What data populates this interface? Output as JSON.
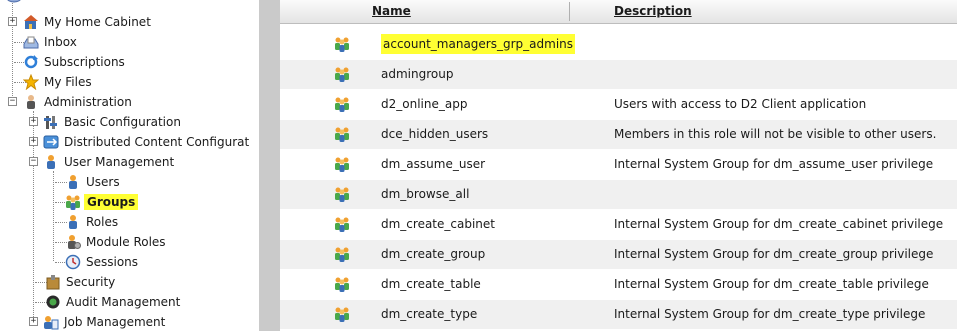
{
  "tree": {
    "items": [
      {
        "label": "My Home Cabinet",
        "icon": "home-cabinet-icon"
      },
      {
        "label": "Inbox",
        "icon": "inbox-icon"
      },
      {
        "label": "Subscriptions",
        "icon": "subscriptions-icon"
      },
      {
        "label": "My Files",
        "icon": "star-icon"
      },
      {
        "label": "Administration",
        "icon": "administration-icon"
      },
      {
        "label": "Basic Configuration",
        "icon": "basic-configuration-icon"
      },
      {
        "label": "Distributed Content Configurat",
        "icon": "distributed-content-icon"
      },
      {
        "label": "User Management",
        "icon": "user-management-icon"
      },
      {
        "label": "Users",
        "icon": "user-icon"
      },
      {
        "label": "Groups",
        "icon": "group-icon"
      },
      {
        "label": "Roles",
        "icon": "role-icon"
      },
      {
        "label": "Module Roles",
        "icon": "module-role-icon"
      },
      {
        "label": "Sessions",
        "icon": "sessions-icon"
      },
      {
        "label": "Security",
        "icon": "security-icon"
      },
      {
        "label": "Audit Management",
        "icon": "audit-icon"
      },
      {
        "label": "Job Management",
        "icon": "job-management-icon"
      }
    ]
  },
  "grid": {
    "columns": {
      "name": "Name",
      "description": "Description"
    },
    "rows": [
      {
        "name": "account_managers_grp_admins",
        "description": ""
      },
      {
        "name": "admingroup",
        "description": ""
      },
      {
        "name": "d2_online_app",
        "description": "Users with access to D2 Client application"
      },
      {
        "name": "dce_hidden_users",
        "description": "Members in this role will not be visible to other users."
      },
      {
        "name": "dm_assume_user",
        "description": "Internal System Group for dm_assume_user privilege"
      },
      {
        "name": "dm_browse_all",
        "description": ""
      },
      {
        "name": "dm_create_cabinet",
        "description": "Internal System Group for dm_create_cabinet privilege"
      },
      {
        "name": "dm_create_group",
        "description": "Internal System Group for dm_create_group privilege"
      },
      {
        "name": "dm_create_table",
        "description": "Internal System Group for dm_create_table privilege"
      },
      {
        "name": "dm_create_type",
        "description": "Internal System Group for dm_create_type privilege"
      }
    ]
  },
  "colors": {
    "highlight": "#ffff33",
    "splitter": "#cacaca",
    "row_alt": "#f0f0f0"
  }
}
